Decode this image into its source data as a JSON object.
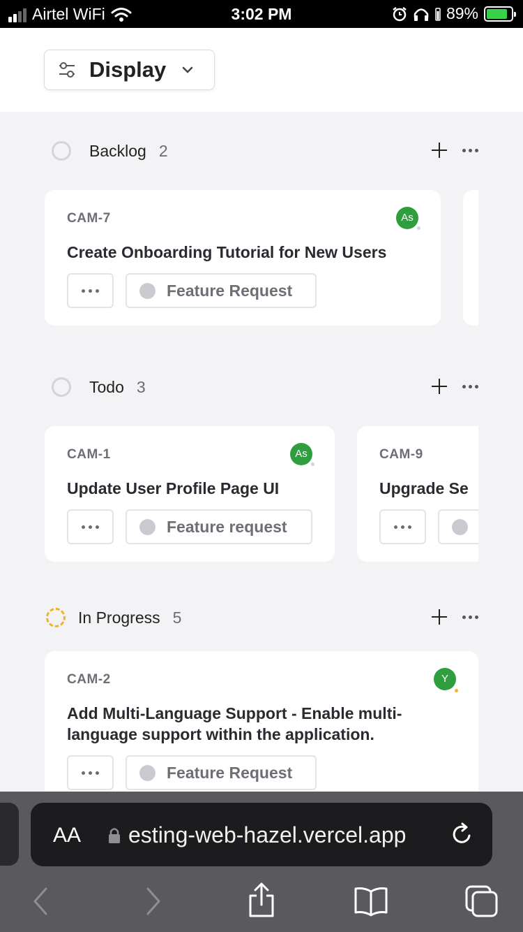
{
  "status_bar": {
    "carrier": "Airtel WiFi",
    "time": "3:02 PM",
    "battery": "89%"
  },
  "header": {
    "display_label": "Display"
  },
  "groups": [
    {
      "title": "Backlog",
      "count": "2",
      "cards": [
        {
          "id": "CAM-7",
          "title": "Create Onboarding Tutorial for New Users",
          "avatar": "As",
          "label": "Feature Request"
        }
      ]
    },
    {
      "title": "Todo",
      "count": "3",
      "cards": [
        {
          "id": "CAM-1",
          "title": "Update User Profile Page UI",
          "avatar": "As",
          "label": "Feature request"
        },
        {
          "id": "CAM-9",
          "title": "Upgrade Se"
        }
      ]
    },
    {
      "title": "In Progress",
      "count": "5",
      "cards": [
        {
          "id": "CAM-2",
          "title": "Add Multi-Language Support - Enable multi-language support within the application.",
          "avatar": "Y",
          "label": "Feature Request"
        }
      ]
    }
  ],
  "safari": {
    "text_size_label": "AA",
    "url": "esting-web-hazel.vercel.app"
  },
  "colors": {
    "avatar_green": "#2e9e3e",
    "in_progress_yellow": "#f1b12e",
    "background": "#f3f3f6"
  }
}
